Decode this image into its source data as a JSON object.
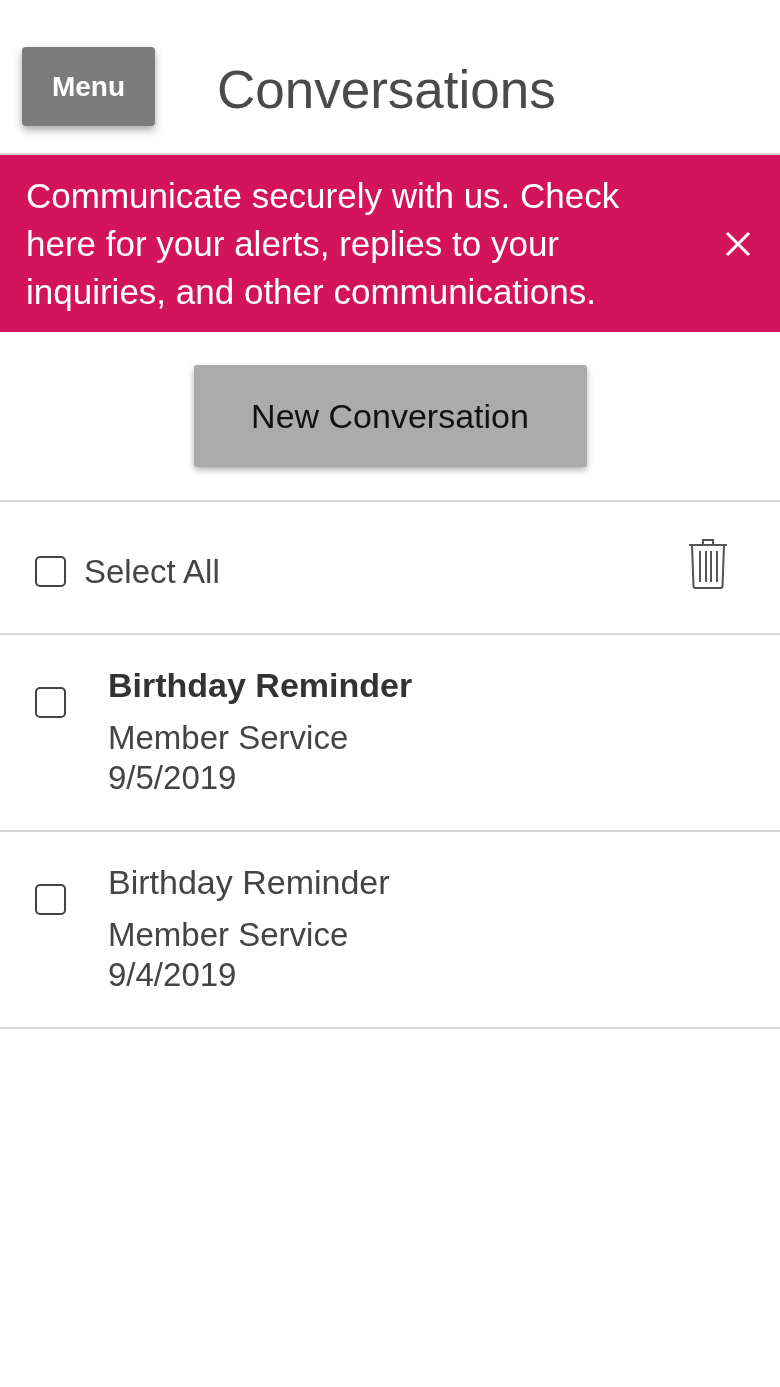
{
  "header": {
    "menu_button": "Menu",
    "title": "Conversations"
  },
  "banner": {
    "message": "Communicate securely with us. Check here for your alerts, replies to your inquiries, and other communications."
  },
  "new_conversation_button": "New Conversation",
  "toolbar": {
    "select_all": {
      "label": "Select All",
      "checked": false
    }
  },
  "conversations": [
    {
      "title": "Birthday Reminder",
      "unread": true,
      "sender": "Member Service",
      "date": "9/5/2019",
      "checked": false
    },
    {
      "title": "Birthday Reminder",
      "unread": false,
      "sender": "Member Service",
      "date": "9/4/2019",
      "checked": false
    }
  ]
}
